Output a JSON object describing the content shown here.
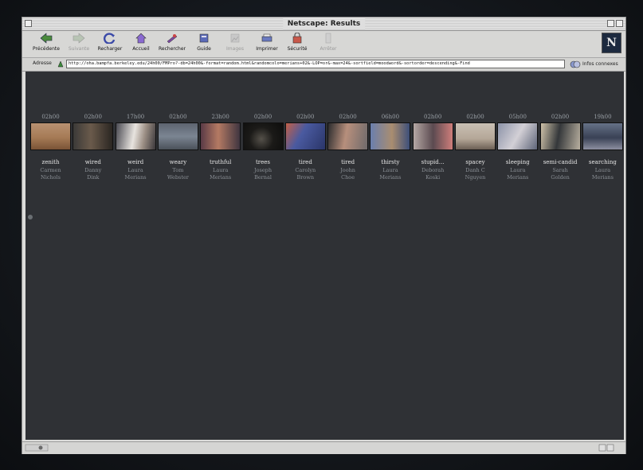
{
  "window": {
    "title": "Netscape: Results"
  },
  "toolbar": {
    "buttons": [
      {
        "label": "Précédente",
        "enabled": true,
        "icon": "back-icon"
      },
      {
        "label": "Suivante",
        "enabled": false,
        "icon": "forward-icon"
      },
      {
        "label": "Recharger",
        "enabled": true,
        "icon": "reload-icon"
      },
      {
        "label": "Accueil",
        "enabled": true,
        "icon": "home-icon"
      },
      {
        "label": "Rechercher",
        "enabled": true,
        "icon": "search-icon"
      },
      {
        "label": "Guide",
        "enabled": true,
        "icon": "guide-icon"
      },
      {
        "label": "Images",
        "enabled": false,
        "icon": "images-icon"
      },
      {
        "label": "Imprimer",
        "enabled": true,
        "icon": "print-icon"
      },
      {
        "label": "Sécurité",
        "enabled": true,
        "icon": "security-icon"
      },
      {
        "label": "Arrêter",
        "enabled": false,
        "icon": "stop-icon"
      }
    ],
    "logo": "N"
  },
  "location": {
    "label": "Adresse",
    "url": "http://oha.bampfa.berkeley.edu/24h00/FMPro?-db=24h00&-format=random.html&randomcolo=merians+02&-LOP=or&-max=24&-sortfield=moodword&-sortorder=descending&-Find",
    "infos_label": "Infos connexes"
  },
  "results": [
    {
      "time": "02h00",
      "word": "zenith",
      "name": [
        "Carmen",
        "Nichols"
      ]
    },
    {
      "time": "02h00",
      "word": "wired",
      "name": [
        "Danny",
        "Dink"
      ]
    },
    {
      "time": "17h00",
      "word": "weird",
      "name": [
        "Laura",
        "Merians"
      ]
    },
    {
      "time": "02h00",
      "word": "weary",
      "name": [
        "Tom",
        "Webster"
      ]
    },
    {
      "time": "23h00",
      "word": "truthful",
      "name": [
        "Laura",
        "Merians"
      ]
    },
    {
      "time": "02h00",
      "word": "trees",
      "name": [
        "Joseph",
        "Bernal"
      ]
    },
    {
      "time": "02h00",
      "word": "tired",
      "name": [
        "Carolyn",
        "Brown"
      ]
    },
    {
      "time": "02h00",
      "word": "tired",
      "name": [
        "Joohn",
        "Choe"
      ]
    },
    {
      "time": "06h00",
      "word": "thirsty",
      "name": [
        "Laura",
        "Merians"
      ]
    },
    {
      "time": "02h00",
      "word": "stupid…",
      "name": [
        "Deborah",
        "Koski"
      ]
    },
    {
      "time": "02h00",
      "word": "spacey",
      "name": [
        "Danh C",
        "Nguyen"
      ]
    },
    {
      "time": "05h00",
      "word": "sleeping",
      "name": [
        "Laura",
        "Merians"
      ]
    },
    {
      "time": "02h00",
      "word": "semi-candid",
      "name": [
        "Sarah",
        "Golden"
      ]
    },
    {
      "time": "19h00",
      "word": "searching",
      "name": [
        "Laura",
        "Merians"
      ]
    }
  ],
  "colors": {
    "page_background": "#2f3135",
    "text_light": "#e6e6e6",
    "text_dim": "#8b9096"
  }
}
